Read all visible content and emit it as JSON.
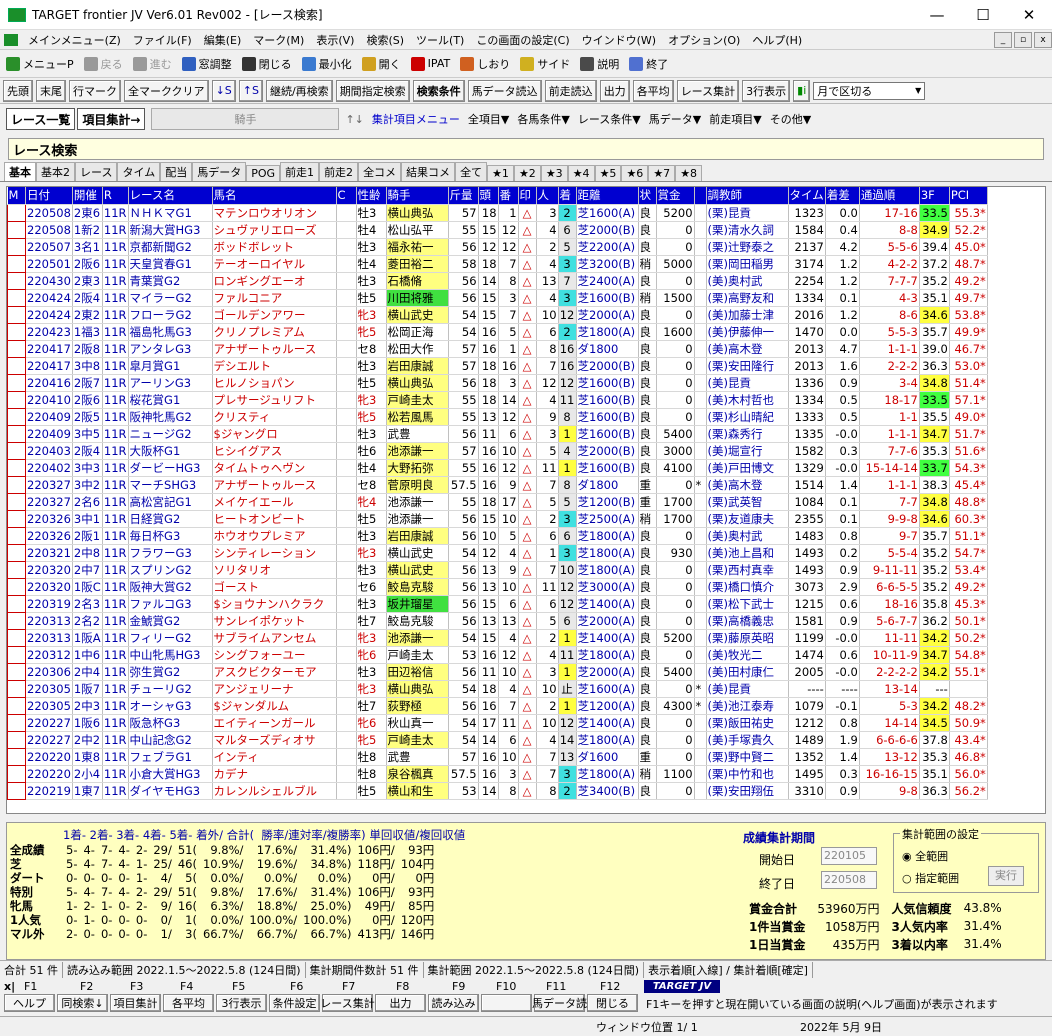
{
  "window": {
    "title": "TARGET frontier JV  Ver6.01  Rev002 - [レース検索]"
  },
  "menu": [
    "メインメニュー(Z)",
    "ファイル(F)",
    "編集(E)",
    "マーク(M)",
    "表示(V)",
    "検索(S)",
    "ツール(T)",
    "この画面の設定(C)",
    "ウインドウ(W)",
    "オプション(O)",
    "ヘルプ(H)"
  ],
  "toolbar1": [
    "メニューP",
    "戻る",
    "進む",
    "窓調整",
    "閉じる",
    "最小化",
    "開く",
    "IPAT",
    "しおり",
    "サイド",
    "説明",
    "終了"
  ],
  "toolbar2": {
    "buttons": [
      "先頭",
      "末尾",
      "行マーク",
      "全マーククリア",
      "↓S",
      "↑S",
      "継続/再検索",
      "期間指定検索",
      "検索条件",
      "馬データ読込",
      "前走読込",
      "出力",
      "各平均",
      "レース集計",
      "3行表示"
    ],
    "select": "月で区切る"
  },
  "toolbar3": {
    "list_btn": "レース一覧",
    "agg_btn": "項目集計→",
    "combo": "騎手",
    "link": "集計項目メニュー",
    "dropdowns": [
      "全項目▼",
      "各馬条件▼",
      "レース条件▼",
      "馬データ▼",
      "前走項目▼",
      "その他▼"
    ]
  },
  "search_title": "レース検索",
  "tabs": [
    "基本",
    "基本2",
    "レース",
    "タイム",
    "配当",
    "馬データ",
    "POG",
    "前走1",
    "前走2",
    "全コメ",
    "結果コメ",
    "全て",
    "★1",
    "★2",
    "★3",
    "★4",
    "★5",
    "★6",
    "★7",
    "★8"
  ],
  "columns": [
    "M",
    "日付",
    "開催",
    "R",
    "レース名",
    "馬名",
    "C",
    "性齢",
    "騎手",
    "斤量",
    "頭",
    "番",
    "印",
    "人",
    "着",
    "距離",
    "状",
    "賞金",
    "",
    "調教師",
    "タイム",
    "着差",
    "通過順",
    "3F",
    "PCI"
  ],
  "rows": [
    [
      "",
      "220508",
      "2東6",
      "11R",
      "ＮＨＫマG1",
      "マテンロウオリオン",
      "",
      "牡3",
      "横山典弘",
      "57",
      "18",
      "1",
      "△",
      "3",
      "2",
      "芝1600(A)",
      "良",
      "5200",
      "",
      "(栗)昆貢",
      "1323",
      "0.0",
      "17-16",
      "33.5",
      "55.3*"
    ],
    [
      "",
      "220508",
      "1新2",
      "11R",
      "新潟大賞HG3",
      "シュヴァリエローズ",
      "",
      "牡4",
      "松山弘平",
      "55",
      "15",
      "12",
      "△",
      "4",
      "6",
      "芝2000(B)",
      "良",
      "0",
      "",
      "(栗)清水久詞",
      "1584",
      "0.4",
      "8-8",
      "34.9",
      "52.2*"
    ],
    [
      "",
      "220507",
      "3名1",
      "11R",
      "京都新聞G2",
      "ボッドボレット",
      "",
      "牡3",
      "福永祐一",
      "56",
      "12",
      "12",
      "△",
      "2",
      "5",
      "芝2200(A)",
      "良",
      "0",
      "",
      "(栗)辻野泰之",
      "2137",
      "4.2",
      "5-5-6",
      "39.4",
      "45.0*"
    ],
    [
      "",
      "220501",
      "2阪6",
      "11R",
      "天皇賞春G1",
      "テーオーロイヤル",
      "",
      "牡4",
      "菱田裕二",
      "58",
      "18",
      "7",
      "△",
      "4",
      "3",
      "芝3200(B)",
      "稍",
      "5000",
      "",
      "(栗)岡田稲男",
      "3174",
      "1.2",
      "4-2-2",
      "37.2",
      "48.7*"
    ],
    [
      "",
      "220430",
      "2東3",
      "11R",
      "青葉賞G2",
      "ロンギングエーオ",
      "",
      "牡3",
      "石橋脩",
      "56",
      "14",
      "8",
      "△",
      "13",
      "7",
      "芝2400(A)",
      "良",
      "0",
      "",
      "(美)奥村武",
      "2254",
      "1.2",
      "7-7-7",
      "35.2",
      "49.2*"
    ],
    [
      "",
      "220424",
      "2阪4",
      "11R",
      "マイラーG2",
      "ファルコニア",
      "",
      "牡5",
      "川田将雅",
      "56",
      "15",
      "3",
      "△",
      "4",
      "3",
      "芝1600(B)",
      "稍",
      "1500",
      "",
      "(栗)高野友和",
      "1334",
      "0.1",
      "4-3",
      "35.1",
      "49.7*"
    ],
    [
      "",
      "220424",
      "2東2",
      "11R",
      "フローラG2",
      "ゴールデンアワー",
      "",
      "牝3",
      "横山武史",
      "54",
      "15",
      "7",
      "△",
      "10",
      "12",
      "芝2000(A)",
      "良",
      "0",
      "",
      "(美)加藤士津",
      "2016",
      "1.2",
      "8-6",
      "34.6",
      "53.8*"
    ],
    [
      "",
      "220423",
      "1福3",
      "11R",
      "福島牝馬G3",
      "クリノプレミアム",
      "",
      "牝5",
      "松岡正海",
      "54",
      "16",
      "5",
      "△",
      "6",
      "2",
      "芝1800(A)",
      "良",
      "1600",
      "",
      "(美)伊藤伸一",
      "1470",
      "0.0",
      "5-5-3",
      "35.7",
      "49.9*"
    ],
    [
      "",
      "220417",
      "2阪8",
      "11R",
      "アンタレG3",
      "アナザートゥルース",
      "",
      "セ8",
      "松田大作",
      "57",
      "16",
      "1",
      "△",
      "8",
      "16",
      "ダ1800",
      "良",
      "0",
      "",
      "(美)高木登",
      "2013",
      "4.7",
      "1-1-1",
      "39.0",
      "46.7*"
    ],
    [
      "",
      "220417",
      "3中8",
      "11R",
      "皐月賞G1",
      "デシエルト",
      "",
      "牡3",
      "岩田康誠",
      "57",
      "18",
      "16",
      "△",
      "7",
      "16",
      "芝2000(B)",
      "良",
      "0",
      "",
      "(栗)安田隆行",
      "2013",
      "1.6",
      "2-2-2",
      "36.3",
      "53.0*"
    ],
    [
      "",
      "220416",
      "2阪7",
      "11R",
      "アーリンG3",
      "ヒルノショパン",
      "",
      "牡5",
      "横山典弘",
      "56",
      "18",
      "3",
      "△",
      "12",
      "12",
      "芝1600(B)",
      "良",
      "0",
      "",
      "(美)昆貢",
      "1336",
      "0.9",
      "3-4",
      "34.8",
      "51.4*"
    ],
    [
      "",
      "220410",
      "2阪6",
      "11R",
      "桜花賞G1",
      "プレサージュリフト",
      "",
      "牝3",
      "戸崎圭太",
      "55",
      "18",
      "14",
      "△",
      "4",
      "11",
      "芝1600(B)",
      "良",
      "0",
      "",
      "(美)木村哲也",
      "1334",
      "0.5",
      "18-17",
      "33.5",
      "57.1*"
    ],
    [
      "",
      "220409",
      "2阪5",
      "11R",
      "阪神牝馬G2",
      "クリスティ",
      "",
      "牝5",
      "松若風馬",
      "55",
      "13",
      "12",
      "△",
      "9",
      "8",
      "芝1600(B)",
      "良",
      "0",
      "",
      "(栗)杉山晴紀",
      "1333",
      "0.5",
      "1-1",
      "35.5",
      "49.0*"
    ],
    [
      "",
      "220409",
      "3中5",
      "11R",
      "ニュージG2",
      "$ジャングロ",
      "",
      "牡3",
      "武豊",
      "56",
      "11",
      "6",
      "△",
      "3",
      "1",
      "芝1600(B)",
      "良",
      "5400",
      "",
      "(栗)森秀行",
      "1335",
      "-0.0",
      "1-1-1",
      "34.7",
      "51.7*"
    ],
    [
      "",
      "220403",
      "2阪4",
      "11R",
      "大阪杯G1",
      "ヒシイグアス",
      "",
      "牡6",
      "池添謙一",
      "57",
      "16",
      "10",
      "△",
      "5",
      "4",
      "芝2000(B)",
      "良",
      "3000",
      "",
      "(美)堀宣行",
      "1582",
      "0.3",
      "7-7-6",
      "35.3",
      "51.6*"
    ],
    [
      "",
      "220402",
      "3中3",
      "11R",
      "ダービーHG3",
      "タイムトゥヘヴン",
      "",
      "牡4",
      "大野拓弥",
      "55",
      "16",
      "12",
      "△",
      "11",
      "1",
      "芝1600(B)",
      "良",
      "4100",
      "",
      "(美)戸田博文",
      "1329",
      "-0.0",
      "15-14-14",
      "33.7",
      "54.3*"
    ],
    [
      "",
      "220327",
      "3中2",
      "11R",
      "マーチSHG3",
      "アナザートゥルース",
      "",
      "セ8",
      "菅原明良",
      "57.5",
      "16",
      "9",
      "△",
      "7",
      "8",
      "ダ1800",
      "重",
      "0",
      "*",
      "(美)高木登",
      "1514",
      "1.4",
      "1-1-1",
      "38.3",
      "45.4*"
    ],
    [
      "",
      "220327",
      "2名6",
      "11R",
      "高松宮記G1",
      "メイケイエール",
      "",
      "牝4",
      "池添謙一",
      "55",
      "18",
      "17",
      "△",
      "5",
      "5",
      "芝1200(B)",
      "重",
      "1700",
      "",
      "(栗)武英智",
      "1084",
      "0.1",
      "7-7",
      "34.8",
      "48.8*"
    ],
    [
      "",
      "220326",
      "3中1",
      "11R",
      "日経賞G2",
      "ヒートオンビート",
      "",
      "牡5",
      "池添謙一",
      "56",
      "15",
      "10",
      "△",
      "2",
      "3",
      "芝2500(A)",
      "稍",
      "1700",
      "",
      "(栗)友道康夫",
      "2355",
      "0.1",
      "9-9-8",
      "34.6",
      "60.3*"
    ],
    [
      "",
      "220326",
      "2阪1",
      "11R",
      "毎日杯G3",
      "ホウオウプレミア",
      "",
      "牡3",
      "岩田康誠",
      "56",
      "10",
      "5",
      "△",
      "6",
      "6",
      "芝1800(A)",
      "良",
      "0",
      "",
      "(美)奥村武",
      "1483",
      "0.8",
      "9-7",
      "35.7",
      "51.1*"
    ],
    [
      "",
      "220321",
      "2中8",
      "11R",
      "フラワーG3",
      "シンティレーション",
      "",
      "牝3",
      "横山武史",
      "54",
      "12",
      "4",
      "△",
      "1",
      "3",
      "芝1800(A)",
      "良",
      "930",
      "",
      "(美)池上昌和",
      "1493",
      "0.2",
      "5-5-4",
      "35.2",
      "54.7*"
    ],
    [
      "",
      "220320",
      "2中7",
      "11R",
      "スプリンG2",
      "ソリタリオ",
      "",
      "牡3",
      "横山武史",
      "56",
      "13",
      "9",
      "△",
      "7",
      "10",
      "芝1800(A)",
      "良",
      "0",
      "",
      "(栗)西村真幸",
      "1493",
      "0.9",
      "9-11-11",
      "35.2",
      "53.4*"
    ],
    [
      "",
      "220320",
      "1阪C",
      "11R",
      "阪神大賞G2",
      "ゴースト",
      "",
      "セ6",
      "鮫島克駿",
      "56",
      "13",
      "10",
      "△",
      "11",
      "12",
      "芝3000(A)",
      "良",
      "0",
      "",
      "(栗)橋口慎介",
      "3073",
      "2.9",
      "6-6-5-5",
      "35.2",
      "49.2*"
    ],
    [
      "",
      "220319",
      "2名3",
      "11R",
      "ファルコG3",
      "$ショウナンハクラク",
      "",
      "牡3",
      "坂井瑠星",
      "56",
      "15",
      "6",
      "△",
      "6",
      "12",
      "芝1400(A)",
      "良",
      "0",
      "",
      "(栗)松下武士",
      "1215",
      "0.6",
      "18-16",
      "35.8",
      "45.3*"
    ],
    [
      "",
      "220313",
      "2名2",
      "11R",
      "金鯱賞G2",
      "サンレイポケット",
      "",
      "牡7",
      "鮫島克駿",
      "56",
      "13",
      "13",
      "△",
      "5",
      "6",
      "芝2000(A)",
      "良",
      "0",
      "",
      "(栗)高橋義忠",
      "1581",
      "0.9",
      "5-6-7-7",
      "36.2",
      "50.1*"
    ],
    [
      "",
      "220313",
      "1阪A",
      "11R",
      "フィリーG2",
      "サブライムアンセム",
      "",
      "牝3",
      "池添謙一",
      "54",
      "15",
      "4",
      "△",
      "2",
      "1",
      "芝1400(A)",
      "良",
      "5200",
      "",
      "(栗)藤原英昭",
      "1199",
      "-0.0",
      "11-11",
      "34.2",
      "50.2*"
    ],
    [
      "",
      "220312",
      "1中6",
      "11R",
      "中山牝馬HG3",
      "シングフォーユー",
      "",
      "牝6",
      "戸崎圭太",
      "53",
      "16",
      "12",
      "△",
      "4",
      "11",
      "芝1800(A)",
      "良",
      "0",
      "",
      "(美)牧光二",
      "1474",
      "0.6",
      "10-11-9",
      "34.7",
      "54.8*"
    ],
    [
      "",
      "220306",
      "2中4",
      "11R",
      "弥生賞G2",
      "アスクビクターモア",
      "",
      "牡3",
      "田辺裕信",
      "56",
      "11",
      "10",
      "△",
      "3",
      "1",
      "芝2000(A)",
      "良",
      "5400",
      "",
      "(美)田村康仁",
      "2005",
      "-0.0",
      "2-2-2-2",
      "34.2",
      "55.1*"
    ],
    [
      "",
      "220305",
      "1阪7",
      "11R",
      "チューリG2",
      "アンジェリーナ",
      "",
      "牝3",
      "横山典弘",
      "54",
      "18",
      "4",
      "△",
      "10",
      "止",
      "芝1600(A)",
      "良",
      "0",
      "*",
      "(美)昆貢",
      "----",
      "----",
      "13-14",
      "---",
      ""
    ],
    [
      "",
      "220305",
      "2中3",
      "11R",
      "オーシャG3",
      "$ジャンダルム",
      "",
      "牡7",
      "荻野極",
      "56",
      "16",
      "7",
      "△",
      "2",
      "1",
      "芝1200(A)",
      "良",
      "4300",
      "*",
      "(美)池江泰寿",
      "1079",
      "-0.1",
      "5-3",
      "34.2",
      "48.2*"
    ],
    [
      "",
      "220227",
      "1阪6",
      "11R",
      "阪急杯G3",
      "エイティーンガール",
      "",
      "牝6",
      "秋山真一",
      "54",
      "17",
      "11",
      "△",
      "10",
      "12",
      "芝1400(A)",
      "良",
      "0",
      "",
      "(栗)飯田祐史",
      "1212",
      "0.8",
      "14-14",
      "34.5",
      "50.9*"
    ],
    [
      "",
      "220227",
      "2中2",
      "11R",
      "中山記念G2",
      "マルターズディオサ",
      "",
      "牝5",
      "戸崎圭太",
      "54",
      "14",
      "6",
      "△",
      "4",
      "14",
      "芝1800(A)",
      "良",
      "0",
      "",
      "(美)手塚貴久",
      "1489",
      "1.9",
      "6-6-6-6",
      "37.8",
      "43.4*"
    ],
    [
      "",
      "220220",
      "1東8",
      "11R",
      "フェブラG1",
      "インティ",
      "",
      "牡8",
      "武豊",
      "57",
      "16",
      "10",
      "△",
      "7",
      "13",
      "ダ1600",
      "重",
      "0",
      "",
      "(栗)野中賢二",
      "1352",
      "1.4",
      "13-12",
      "35.3",
      "46.8*"
    ],
    [
      "",
      "220220",
      "2小4",
      "11R",
      "小倉大賞HG3",
      "カデナ",
      "",
      "牡8",
      "泉谷楓真",
      "57.5",
      "16",
      "3",
      "△",
      "7",
      "3",
      "芝1800(A)",
      "稍",
      "1100",
      "",
      "(栗)中竹和也",
      "1495",
      "0.3",
      "16-16-15",
      "35.1",
      "56.0*"
    ],
    [
      "",
      "220219",
      "1東7",
      "11R",
      "ダイヤモHG3",
      "カレンルシェルブル",
      "",
      "牡5",
      "横山和生",
      "53",
      "14",
      "8",
      "△",
      "8",
      "2",
      "芝3400(B)",
      "良",
      "0",
      "",
      "(栗)安田翔伍",
      "3310",
      "0.9",
      "9-8",
      "36.3",
      "56.2*"
    ]
  ],
  "summary": {
    "header": "1着- 2着- 3着- 4着- 5着- 着外/ 合計(  勝率/連対率/複勝率) 単回収値/複回収値",
    "rows": [
      [
        "全成績",
        "5-",
        "4-",
        "7-",
        "4-",
        "2-",
        "29/",
        "51(",
        "9.8%/",
        "17.6%/",
        "31.4%)",
        "106円/",
        "93円"
      ],
      [
        "芝",
        "5-",
        "4-",
        "7-",
        "4-",
        "1-",
        "25/",
        "46(",
        "10.9%/",
        "19.6%/",
        "34.8%)",
        "118円/",
        "104円"
      ],
      [
        "ダート",
        "0-",
        "0-",
        "0-",
        "0-",
        "1-",
        "4/",
        "5(",
        "0.0%/",
        "0.0%/",
        "0.0%)",
        "0円/",
        "0円"
      ],
      [
        "特別",
        "5-",
        "4-",
        "7-",
        "4-",
        "2-",
        "29/",
        "51(",
        "9.8%/",
        "17.6%/",
        "31.4%)",
        "106円/",
        "93円"
      ],
      [
        "牝馬",
        "1-",
        "2-",
        "1-",
        "0-",
        "2-",
        "9/",
        "16(",
        "6.3%/",
        "18.8%/",
        "25.0%)",
        "49円/",
        "85円"
      ],
      [
        "1人気",
        "0-",
        "1-",
        "0-",
        "0-",
        "0-",
        "0/",
        "1(",
        "0.0%/",
        "100.0%/",
        "100.0%)",
        "0円/",
        "120円"
      ],
      [
        "マル外",
        "2-",
        "0-",
        "0-",
        "0-",
        "0-",
        "1/",
        "3(",
        "66.7%/",
        "66.7%/",
        "66.7%)",
        "413円/",
        "146円"
      ]
    ],
    "period_title": "成績集計期間",
    "start_label": "開始日",
    "start": "220105",
    "end_label": "終了日",
    "end": "220508",
    "range_title": "集計範囲の設定",
    "range_all": "全範囲",
    "range_spec": "指定範囲",
    "run": "実行",
    "stats": [
      [
        "賞金合計",
        "53960万円",
        "人気信頼度",
        "43.8%"
      ],
      [
        "1件当賞金",
        "1058万円",
        "3人気内率",
        "31.4%"
      ],
      [
        "1日当賞金",
        "435万円",
        "3着以内率",
        "31.4%"
      ]
    ]
  },
  "status": [
    "合計 51 件",
    "読み込み範囲 2022.1.5～2022.5.8 (124日間)",
    "集計期間件数計 51 件",
    "集計範囲 2022.1.5～2022.5.8 (124日間)",
    "表示着順[入線] / 集計着順[確定]"
  ],
  "fkeys": {
    "labels": [
      "F1",
      "F2",
      "F3",
      "F4",
      "F5",
      "F6",
      "F7",
      "F8",
      "F9",
      "F10",
      "F11",
      "F12"
    ],
    "buttons": [
      "ヘルプ",
      "同検索↓",
      "項目集計",
      "各平均",
      "3行表示",
      "条件設定",
      "レース集計",
      "出力",
      "読み込み",
      "",
      "馬データ読",
      "閉じる"
    ],
    "logo": "TARGET JV",
    "help": "F1キーを押すと現在開いている画面の説明(ヘルプ画面)が表示されます"
  },
  "bottom": {
    "window_pos": "ウィンドウ位置 1/ 1",
    "date": "2022年 5月 9日"
  }
}
